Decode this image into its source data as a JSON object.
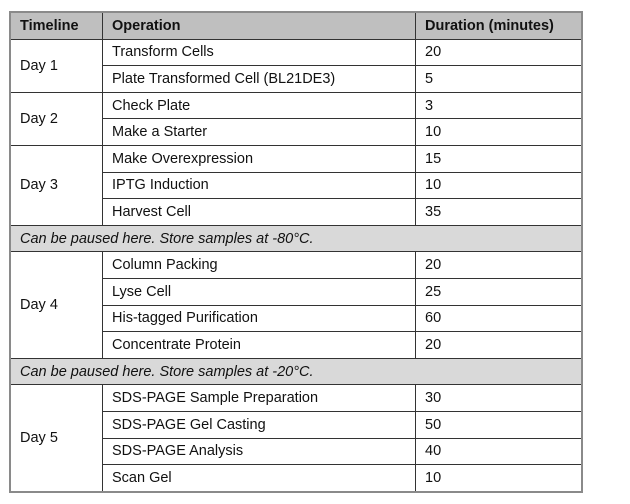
{
  "headers": [
    "Timeline",
    "Operation",
    "Duration (minutes)"
  ],
  "groups": [
    {
      "day": "Day 1",
      "rows": [
        [
          "Transform Cells",
          "20"
        ],
        [
          "Plate Transformed Cell (BL21DE3)",
          "5"
        ]
      ]
    },
    {
      "day": "Day 2",
      "rows": [
        [
          "Check Plate",
          "3"
        ],
        [
          "Make a Starter",
          "10"
        ]
      ]
    },
    {
      "day": "Day 3",
      "rows": [
        [
          "Make Overexpression",
          "15"
        ],
        [
          "IPTG Induction",
          "10"
        ],
        [
          "Harvest Cell",
          "35"
        ]
      ],
      "pause": "Can be paused here. Store samples at -80°C."
    },
    {
      "day": "Day 4",
      "rows": [
        [
          "Column Packing",
          "20"
        ],
        [
          "Lyse Cell",
          "25"
        ],
        [
          "His-tagged Purification",
          "60"
        ],
        [
          "Concentrate Protein",
          "20"
        ]
      ],
      "pause": "Can be paused here. Store samples at -20°C."
    },
    {
      "day": "Day 5",
      "rows": [
        [
          "SDS-PAGE Sample Preparation",
          "30"
        ],
        [
          "SDS-PAGE Gel Casting",
          "50"
        ],
        [
          "SDS-PAGE Analysis",
          "40"
        ],
        [
          "Scan Gel",
          "10"
        ]
      ]
    }
  ],
  "colors": {
    "header_bg": "#bfbfbf",
    "pause_bg": "#d9d9d9"
  }
}
